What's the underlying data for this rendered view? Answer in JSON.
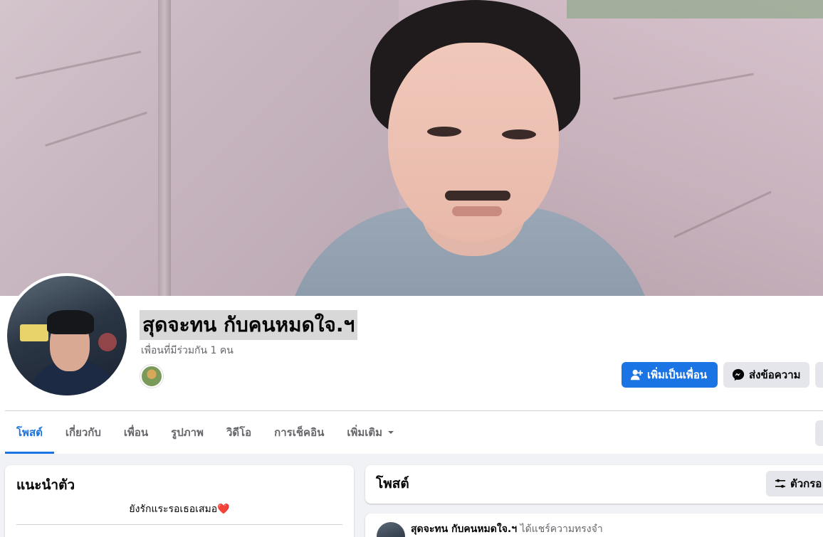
{
  "profile": {
    "name": "สุดจะทน กับคนหมดใจ.ฯ",
    "mutual_friends": "เพื่อนที่มีร่วมกัน 1 คน"
  },
  "actions": {
    "add_friend": "เพิ่มเป็นเพื่อน",
    "message": "ส่งข้อความ"
  },
  "tabs": [
    {
      "label": "โพสต์",
      "active": true
    },
    {
      "label": "เกี่ยวกับ",
      "active": false
    },
    {
      "label": "เพื่อน",
      "active": false
    },
    {
      "label": "รูปภาพ",
      "active": false
    },
    {
      "label": "วิดีโอ",
      "active": false
    },
    {
      "label": "การเช็คอิน",
      "active": false
    },
    {
      "label": "เพิ่มเติม",
      "active": false
    }
  ],
  "intro": {
    "title": "แนะนำตัว",
    "bio": "ยังรักแระรอเธอเสมอ",
    "bio_emoji": "❤️"
  },
  "posts": {
    "title": "โพสต์",
    "filter_label": "ตัวกรอ",
    "first_post": {
      "author": "สุดจะทน กับคนหมดใจ.ฯ",
      "action": "ได้แชร์ความทรงจำ"
    }
  },
  "colors": {
    "primary": "#1b74e4",
    "secondary_button": "#e4e6eb",
    "page_bg": "#f0f2f5",
    "heart": "#e41e3f"
  }
}
